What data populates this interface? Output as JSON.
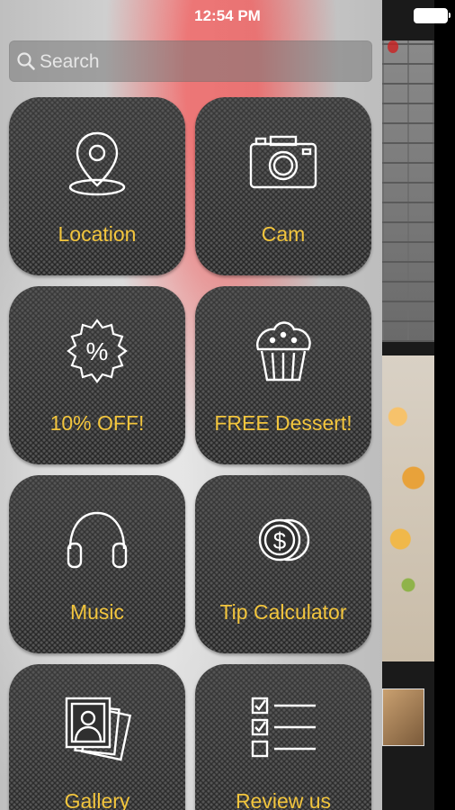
{
  "status_bar": {
    "time": "12:54 PM"
  },
  "search": {
    "placeholder": "Search"
  },
  "menu": {
    "items": [
      {
        "label": "Location",
        "icon": "location-pin-icon"
      },
      {
        "label": "Cam",
        "icon": "camera-icon"
      },
      {
        "label": "10% OFF!",
        "icon": "discount-badge-icon"
      },
      {
        "label": "FREE Dessert!",
        "icon": "muffin-icon"
      },
      {
        "label": "Music",
        "icon": "headphones-icon"
      },
      {
        "label": "Tip Calculator",
        "icon": "coins-dollar-icon"
      },
      {
        "label": "Gallery",
        "icon": "photo-gallery-icon"
      },
      {
        "label": "Review us",
        "icon": "checklist-icon"
      }
    ]
  },
  "colors": {
    "label": "#f2c53d",
    "tile": "#2f2f2f"
  }
}
